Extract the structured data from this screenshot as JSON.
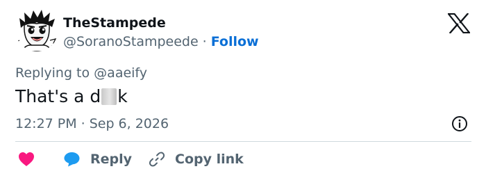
{
  "author": {
    "display_name": "TheStampede",
    "handle": "@SoranoStampeede",
    "separator": "·",
    "follow_label": "Follow"
  },
  "reply_context": {
    "prefix": "Replying to",
    "target": "@aaeify"
  },
  "tweet": {
    "text_before": "That's a d",
    "text_after": "k"
  },
  "meta": {
    "time": "12:27 PM",
    "separator": "·",
    "date": "Sep 6, 2026"
  },
  "actions": {
    "reply_label": "Reply",
    "copy_label": "Copy link"
  },
  "icons": {
    "brand": "x-logo-icon",
    "info": "info-icon",
    "like": "heart-icon",
    "reply": "speech-bubble-icon",
    "copy": "link-icon"
  },
  "colors": {
    "follow": "#0a6fd6",
    "heart": "#f91880",
    "reply_bubble": "#1d9bf0",
    "muted": "#536471",
    "text": "#0f1419"
  }
}
